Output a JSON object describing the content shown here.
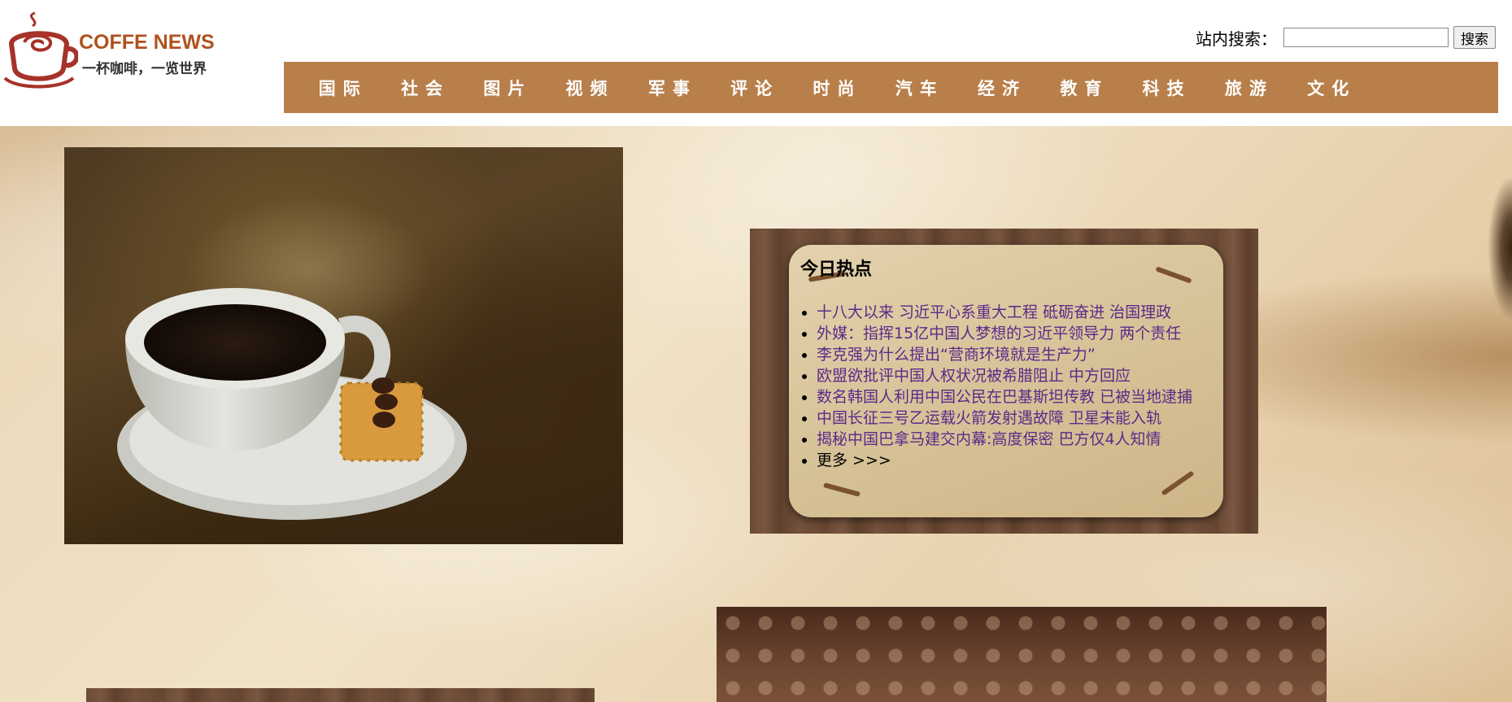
{
  "logo": {
    "title": "COFFE NEWS",
    "slogan": "一杯咖啡，一览世界",
    "icon": "coffee-cup-icon"
  },
  "search": {
    "label": "站内搜索：",
    "input_value": "",
    "button_label": "搜索"
  },
  "nav": {
    "items": [
      {
        "label": "国际"
      },
      {
        "label": "社会"
      },
      {
        "label": "图片"
      },
      {
        "label": "视频"
      },
      {
        "label": "军事"
      },
      {
        "label": "评论"
      },
      {
        "label": "时尚"
      },
      {
        "label": "汽车"
      },
      {
        "label": "经济"
      },
      {
        "label": "教育"
      },
      {
        "label": "科技"
      },
      {
        "label": "旅游"
      },
      {
        "label": "文化"
      }
    ]
  },
  "hot_news": {
    "title": "今日热点",
    "items": [
      {
        "text": "十八大以来 习近平心系重大工程 砥砺奋进 治国理政"
      },
      {
        "text": "外媒：指挥15亿中国人梦想的习近平领导力 两个责任"
      },
      {
        "text": "李克强为什么提出“营商环境就是生产力”"
      },
      {
        "text": "欧盟欲批评中国人权状况被希腊阻止 中方回应"
      },
      {
        "text": "数名韩国人利用中国公民在巴基斯坦传教 已被当地逮捕"
      },
      {
        "text": "中国长征三号乙运载火箭发射遇故障 卫星未能入轨"
      },
      {
        "text": "揭秘中国巴拿马建交内幕:高度保密 巴方仅4人知情"
      }
    ],
    "more_label": "更多 >>>"
  },
  "colors": {
    "nav_bg": "#b97f4b",
    "logo_brand": "#b0521f",
    "link_visited": "#5b2a8a"
  }
}
